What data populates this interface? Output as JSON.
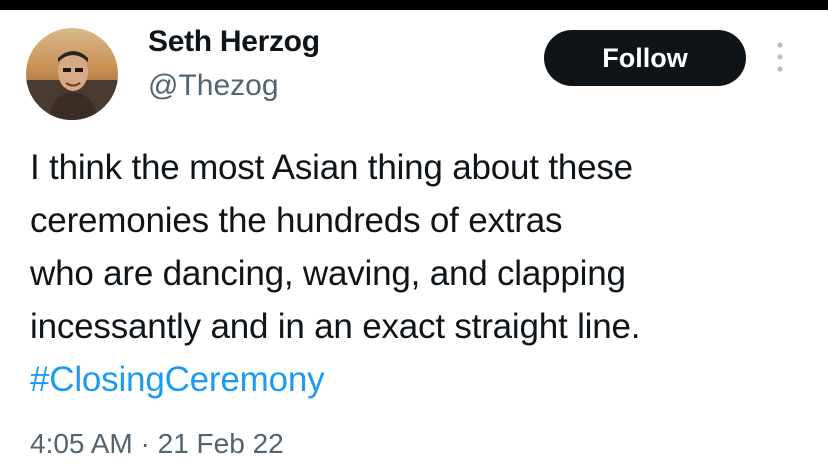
{
  "tweet": {
    "author": {
      "display_name": "Seth Herzog",
      "handle": "@Thezog",
      "avatar": "profile-photo"
    },
    "follow_label": "Follow",
    "more_icon": "more-vertical-icon",
    "text_lines": [
      "I think the most Asian thing about these",
      "ceremonies the hundreds of extras",
      "who are dancing, waving, and clapping",
      "incessantly and in an exact straight line."
    ],
    "hashtag": "#ClosingCeremony",
    "time": "4:05 AM",
    "separator": "·",
    "date": "21 Feb 22"
  },
  "colors": {
    "text_primary": "#0f1419",
    "text_secondary": "#536471",
    "link": "#1d9bf0",
    "button_bg": "#0f1419",
    "button_text": "#ffffff"
  }
}
